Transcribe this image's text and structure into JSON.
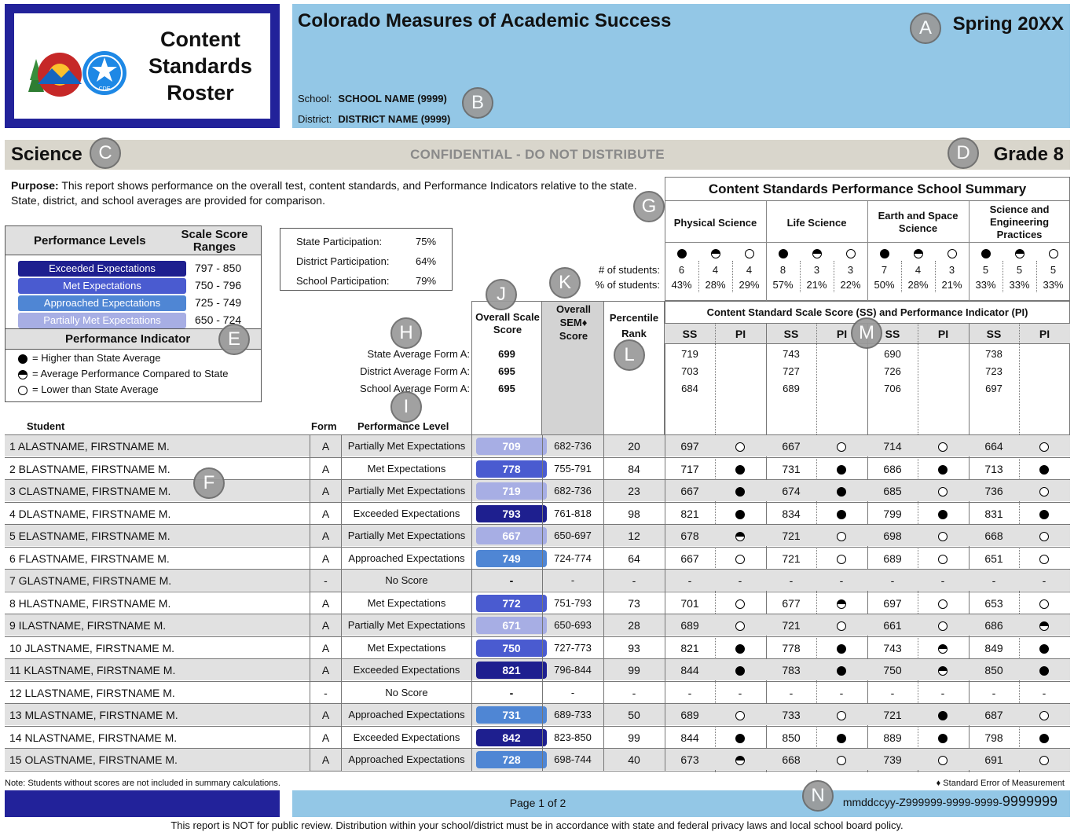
{
  "colors": {
    "exceeded": "#1e1f8f",
    "met": "#4a5bd0",
    "approached": "#4f86d4",
    "partial": "#a7aee4",
    "navy": "#22229a",
    "light_blue": "#93c7e6",
    "band": "#d9d6cc"
  },
  "logo": {
    "title": "Content Standards Roster",
    "icon": "colorado-cde-logo"
  },
  "header": {
    "title": "Colorado Measures of Academic Success",
    "season": "Spring 20XX",
    "school_label": "School:",
    "school_name": "SCHOOL NAME (9999)",
    "district_label": "District:",
    "district_name": "DISTRICT NAME (9999)"
  },
  "band": {
    "subject": "Science",
    "confidential": "CONFIDENTIAL - DO NOT DISTRIBUTE",
    "grade": "Grade 8"
  },
  "purpose": {
    "label": "Purpose:",
    "text": " This report shows performance on the overall test, content standards, and Performance Indicators relative to the state. State, district, and school averages are provided for comparison."
  },
  "perf_levels": {
    "header_left": "Performance Levels",
    "header_right": "Scale Score Ranges",
    "levels": [
      {
        "name": "Exceeded Expectations",
        "range": "797 - 850",
        "color": "#1e1f8f"
      },
      {
        "name": "Met Expectations",
        "range": "750 - 796",
        "color": "#4a5bd0"
      },
      {
        "name": "Approached Expectations",
        "range": "725 - 749",
        "color": "#4f86d4"
      },
      {
        "name": "Partially Met Expectations",
        "range": "650 - 724",
        "color": "#a7aee4"
      }
    ],
    "indicator_title": "Performance Indicator",
    "indicators": [
      {
        "icon": "full-circle-icon",
        "text": "= Higher than State Average"
      },
      {
        "icon": "half-circle-icon",
        "text": "= Average Performance Compared to State"
      },
      {
        "icon": "empty-circle-icon",
        "text": "= Lower than State Average"
      }
    ]
  },
  "participation": [
    {
      "label": "State Participation:",
      "value": "75%"
    },
    {
      "label": "District Participation:",
      "value": "64%"
    },
    {
      "label": "School Participation:",
      "value": "79%"
    }
  ],
  "summary": {
    "title": "Content Standards Performance School Summary",
    "students_label": "# of students:",
    "percent_label": "% of students:",
    "standards": [
      {
        "name": "Physical Science",
        "counts": [
          "6",
          "4",
          "4"
        ],
        "percents": [
          "43%",
          "28%",
          "29%"
        ]
      },
      {
        "name": "Life Science",
        "counts": [
          "8",
          "3",
          "3"
        ],
        "percents": [
          "57%",
          "21%",
          "22%"
        ]
      },
      {
        "name": "Earth and Space Science",
        "counts": [
          "7",
          "4",
          "3"
        ],
        "percents": [
          "50%",
          "28%",
          "21%"
        ]
      },
      {
        "name": "Science and Engineering Practices",
        "counts": [
          "5",
          "5",
          "5"
        ],
        "percents": [
          "33%",
          "33%",
          "33%"
        ]
      }
    ]
  },
  "table": {
    "col_overall": "Overall Scale Score",
    "col_sem": "Overall SEM♦ Score",
    "col_pct": "Percentile Rank",
    "col_content": "Content Standard Scale Score (SS) and Performance Indicator (PI)",
    "ss": "SS",
    "pi": "PI",
    "col_student": "Student",
    "col_form": "Form",
    "col_level": "Performance Level",
    "averages": [
      {
        "label": "State Average Form A:",
        "overall": "699",
        "ss": [
          "719",
          "743",
          "690",
          "738"
        ]
      },
      {
        "label": "District Average Form A:",
        "overall": "695",
        "ss": [
          "703",
          "727",
          "726",
          "723"
        ]
      },
      {
        "label": "School Average Form A:",
        "overall": "695",
        "ss": [
          "684",
          "689",
          "706",
          "697"
        ]
      }
    ],
    "students": [
      {
        "name": "1 ALASTNAME,  FIRSTNAME M.",
        "form": "A",
        "level": "Partially Met Expectations",
        "score": "709",
        "lvl": "partial",
        "sem": "682-736",
        "pct": "20",
        "cs": [
          [
            "697",
            "empty"
          ],
          [
            "667",
            "empty"
          ],
          [
            "714",
            "empty"
          ],
          [
            "664",
            "empty"
          ]
        ]
      },
      {
        "name": "2 BLASTNAME, FIRSTNAME M.",
        "form": "A",
        "level": "Met Expectations",
        "score": "778",
        "lvl": "met",
        "sem": "755-791",
        "pct": "84",
        "cs": [
          [
            "717",
            "full"
          ],
          [
            "731",
            "full"
          ],
          [
            "686",
            "full"
          ],
          [
            "713",
            "full"
          ]
        ]
      },
      {
        "name": "3 CLASTNAME, FIRSTNAME M.",
        "form": "A",
        "level": "Partially Met Expectations",
        "score": "719",
        "lvl": "partial",
        "sem": "682-736",
        "pct": "23",
        "cs": [
          [
            "667",
            "full"
          ],
          [
            "674",
            "full"
          ],
          [
            "685",
            "empty"
          ],
          [
            "736",
            "empty"
          ]
        ]
      },
      {
        "name": "4 DLASTNAME, FIRSTNAME M.",
        "form": "A",
        "level": "Exceeded Expectations",
        "score": "793",
        "lvl": "exceeded",
        "sem": "761-818",
        "pct": "98",
        "cs": [
          [
            "821",
            "full"
          ],
          [
            "834",
            "full"
          ],
          [
            "799",
            "full"
          ],
          [
            "831",
            "full"
          ]
        ]
      },
      {
        "name": "5 ELASTNAME, FIRSTNAME M.",
        "form": "A",
        "level": "Partially Met Expectations",
        "score": "667",
        "lvl": "partial",
        "sem": "650-697",
        "pct": "12",
        "cs": [
          [
            "678",
            "half"
          ],
          [
            "721",
            "empty"
          ],
          [
            "698",
            "empty"
          ],
          [
            "668",
            "empty"
          ]
        ]
      },
      {
        "name": "6 FLASTNAME, FIRSTNAME M.",
        "form": "A",
        "level": "Approached Expectations",
        "score": "749",
        "lvl": "approached",
        "sem": "724-774",
        "pct": "64",
        "cs": [
          [
            "667",
            "empty"
          ],
          [
            "721",
            "empty"
          ],
          [
            "689",
            "empty"
          ],
          [
            "651",
            "empty"
          ]
        ]
      },
      {
        "name": "7 GLASTNAME, FIRSTNAME M.",
        "form": "-",
        "level": "No Score",
        "score": "-",
        "lvl": "none",
        "sem": "-",
        "pct": "-",
        "cs": [
          [
            "-",
            "-"
          ],
          [
            "-",
            "-"
          ],
          [
            "-",
            "-"
          ],
          [
            "-",
            "-"
          ]
        ]
      },
      {
        "name": "8 HLASTNAME, FIRSTNAME M.",
        "form": "A",
        "level": "Met Expectations",
        "score": "772",
        "lvl": "met",
        "sem": "751-793",
        "pct": "73",
        "cs": [
          [
            "701",
            "empty"
          ],
          [
            "677",
            "half"
          ],
          [
            "697",
            "empty"
          ],
          [
            "653",
            "empty"
          ]
        ]
      },
      {
        "name": "9 ILASTNAME, FIRSTNAME M.",
        "form": "A",
        "level": "Partially Met Expectations",
        "score": "671",
        "lvl": "partial",
        "sem": "650-693",
        "pct": "28",
        "cs": [
          [
            "689",
            "empty"
          ],
          [
            "721",
            "empty"
          ],
          [
            "661",
            "empty"
          ],
          [
            "686",
            "half"
          ]
        ]
      },
      {
        "name": "10 JLASTNAME, FIRSTNAME M.",
        "form": "A",
        "level": "Met Expectations",
        "score": "750",
        "lvl": "met",
        "sem": "727-773",
        "pct": "93",
        "cs": [
          [
            "821",
            "full"
          ],
          [
            "778",
            "full"
          ],
          [
            "743",
            "half"
          ],
          [
            "849",
            "full"
          ]
        ]
      },
      {
        "name": "11 KLASTNAME, FIRSTNAME M.",
        "form": "A",
        "level": "Exceeded Expectations",
        "score": "821",
        "lvl": "exceeded",
        "sem": "796-844",
        "pct": "99",
        "cs": [
          [
            "844",
            "full"
          ],
          [
            "783",
            "full"
          ],
          [
            "750",
            "half"
          ],
          [
            "850",
            "full"
          ]
        ]
      },
      {
        "name": "12 LLASTNAME, FIRSTNAME M.",
        "form": "-",
        "level": "No Score",
        "score": "-",
        "lvl": "none",
        "sem": "-",
        "pct": "-",
        "cs": [
          [
            "-",
            "-"
          ],
          [
            "-",
            "-"
          ],
          [
            "-",
            "-"
          ],
          [
            "-",
            "-"
          ]
        ]
      },
      {
        "name": "13 MLASTNAME, FIRSTNAME M.",
        "form": "A",
        "level": "Approached Expectations",
        "score": "731",
        "lvl": "approached",
        "sem": "689-733",
        "pct": "50",
        "cs": [
          [
            "689",
            "empty"
          ],
          [
            "733",
            "empty"
          ],
          [
            "721",
            "full"
          ],
          [
            "687",
            "empty"
          ]
        ]
      },
      {
        "name": "14 NLASTNAME, FIRSTNAME M.",
        "form": "A",
        "level": "Exceeded Expectations",
        "score": "842",
        "lvl": "exceeded",
        "sem": "823-850",
        "pct": "99",
        "cs": [
          [
            "844",
            "full"
          ],
          [
            "850",
            "full"
          ],
          [
            "889",
            "full"
          ],
          [
            "798",
            "full"
          ]
        ]
      },
      {
        "name": "15 OLASTNAME, FIRSTNAME M.",
        "form": "A",
        "level": "Approached Expectations",
        "score": "728",
        "lvl": "approached",
        "sem": "698-744",
        "pct": "40",
        "cs": [
          [
            "673",
            "half"
          ],
          [
            "668",
            "empty"
          ],
          [
            "739",
            "empty"
          ],
          [
            "691",
            "empty"
          ]
        ]
      }
    ]
  },
  "notes": {
    "left": "Note: Students without scores are not included in summary calculations.",
    "right": "♦ Standard Error of Measurement"
  },
  "footer": {
    "page": "Page 1 of 2",
    "code_small": "mmddccyy-Z999999-9999-9999-",
    "code_big": "9999999",
    "disclaimer": "This report is NOT for public review. Distribution within your school/district must be in accordance with state and federal privacy laws and local school board policy."
  },
  "callouts": [
    "A",
    "B",
    "C",
    "D",
    "E",
    "F",
    "G",
    "H",
    "I",
    "J",
    "K",
    "L",
    "M",
    "N"
  ]
}
